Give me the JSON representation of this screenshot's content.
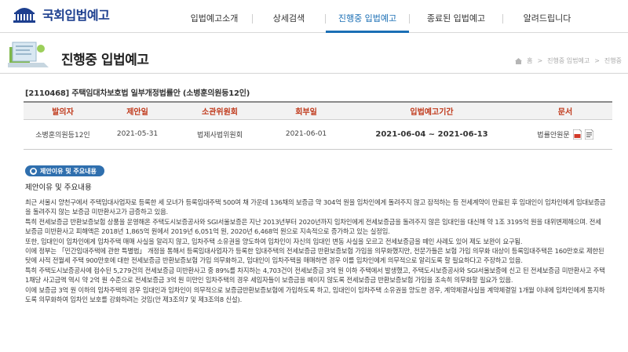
{
  "site": {
    "logo_text": "국회입법예고"
  },
  "nav": {
    "items": [
      {
        "label": "입법예고소개"
      },
      {
        "label": "상세검색"
      },
      {
        "label": "진행중 입법예고"
      },
      {
        "label": "종료된 입법예고"
      },
      {
        "label": "알려드립니다"
      }
    ],
    "active_index": 2
  },
  "page": {
    "title": "진행중 입법예고",
    "breadcrumb": [
      "홈",
      "진행중 입법예고",
      "진행중"
    ]
  },
  "bill": {
    "title": "[2110468] 주택임대차보호법 일부개정법률안 (소병훈의원등12인)"
  },
  "table": {
    "headers": [
      "발의자",
      "제안일",
      "소관위원회",
      "회부일",
      "입법예고기간",
      "문서"
    ],
    "row": {
      "proposer": "소병훈의원등12인",
      "proposal_date": "2021-05-31",
      "committee": "법제사법위원회",
      "referral_date": "2021-06-01",
      "period": "2021-06-04 ~ 2021-06-13",
      "document": "법률안원문"
    }
  },
  "content": {
    "badge": "제안이유 및 주요내용",
    "heading": "제안이유 및 주요내용",
    "paragraphs": [
      "최근 서울시 양천구에서 주택임대사업자로 등록한 세 모녀가 등록임대주택 500여 채 가운데 136채의 보증금 약 304억 원을 임차인에게 돌려주지 않고 잠적하는 등 전세계약이 만료된 후 임대인이 임차인에게 임대보증금을 돌려주지 않는 보증금 미반환사고가 급증하고 있음.",
      "특히 전세보증금 반환보증보험 상품을 운영해온 주택도시보증공사와 SGI서울보증은 지난 2013년부터 2020년까지 임차인에게 전세보증금을 돌려주지 않은 임대인을 대신해 약 1조 3195억 원을 대위변제해으며. 전세보증금 미반환사고 피해액은 2018년 1,865억 원에서 2019년 6,051억 원, 2020년 6,468억 원으로 지속적으로 증가하고 있는 실정임.",
      "또한, 임대인이 임차인에게 임차주택 매매 사실을 알리지 않고, 임차주택 소유권을 양도하여 임차인이 자신의 임대인 변동 사실을 모르고 전세보증금을 떼인 사례도 있어 제도 보완이 요구됨.",
      "이에 정부는 「민간임대주택에 관한 특별법」 개정을 통해서 등록임대사업자가 등록한 임대주택의 전세보증금 반환보증보험 가입을 의무화했지만, 전문가들은 보험 가입 의무화 대상이 등록임대주택은 160만호로 제한된 탓에 사적 전월세 주택 900만호에 대한 전세보증금 반환보증보험 가입 의무화하고, 임대인이 임차주택을 매매하면 경우 이를 임차인에게 의무적으로 알리도록 할 필요하다고 주장하고 있음.",
      "특히 주택도시보증공사에 접수된 5,279건의 전세보증금 미반환사고 중 89%를 차지하는 4,703건이 전세보증금 3억 원 이하 주택에서 발생했고, 주택도시보증공사와 SGI서울보증에 신고 된 전세보증금 미반환사고 주택 1채당 사고금액 역시 약 2억 원 수준으로 전세보증금 3억 원 미만인 임차주택의 경우 세입자들이 보증금을 떼이지 않도록 전세보증금 반환보증보험 가입을 조속히 의무화할 필요가 있음.",
      "이에 보증금 3억 원 이하의 임차주택의 경우 임대인과 임차인이 의무적으로 보증금반환보증보험에 가입하도록 하고, 임대인이 임차주택 소유권을 양도한 경우, 계약체결사실을 계약체결일 1개월 이내에 임차인에게 통지하도록 의무화하여 임차인 보호를 강화하려는 것임(안 제3조의7 및 제3조의8 신설)."
    ]
  },
  "colors": {
    "brand": "#1d3f8f",
    "active_nav": "#1b6fb5",
    "table_header_text": "#c0391b",
    "badge_bg": "#2f6fae"
  }
}
